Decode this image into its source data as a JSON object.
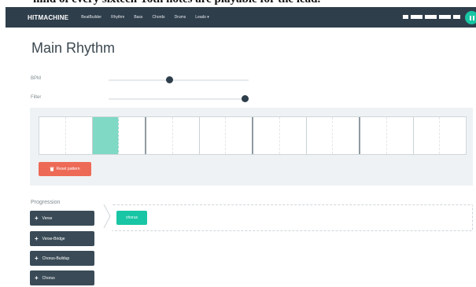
{
  "caption": "hind of every sixteen-16th notes are playable for the lead.",
  "navbar": {
    "brand": "HITMACHINE",
    "items": [
      "BeatBuilder",
      "Rhythm",
      "Bass",
      "Chords",
      "Drums",
      "Leads ▾"
    ]
  },
  "page": {
    "title": "Main Rhythm"
  },
  "controls": {
    "bpm_label": "BPM",
    "filter_label": "Filter",
    "bpm_level": 0.43,
    "filter_level": 0.97
  },
  "sequencer": {
    "steps": 16,
    "active_steps": [
      2
    ],
    "reset_label": "Reset pattern"
  },
  "progression": {
    "label": "Progression",
    "buttons": [
      "Verse",
      "Verse-Bridge",
      "Chorus-Buildup",
      "Chorus"
    ],
    "chips": [
      "chorus"
    ]
  },
  "colors": {
    "accent": "#18c5a4",
    "navbar": "#2f3e4b",
    "danger": "#ed6a56",
    "button": "#3a4b57"
  }
}
